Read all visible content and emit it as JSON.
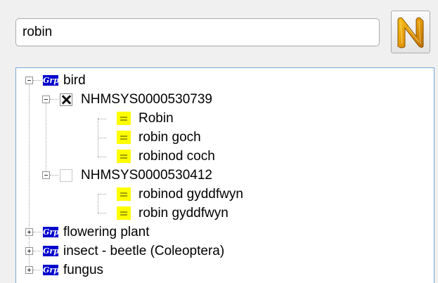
{
  "search": {
    "value": "robin"
  },
  "logo": {
    "icon": "n-logo-icon",
    "letter": "N"
  },
  "tree": {
    "groups": [
      {
        "label": "bird",
        "expanded": true,
        "icon_text": "Grp",
        "children": [
          {
            "label": "NHMSYS0000530739",
            "checked": true,
            "names": [
              "Robin",
              "robin goch",
              "robinod coch"
            ]
          },
          {
            "label": "NHMSYS0000530412",
            "checked": false,
            "names": [
              "robinod gyddfwyn",
              "robin gyddfwyn"
            ]
          }
        ]
      },
      {
        "label": "flowering plant",
        "expanded": false,
        "icon_text": "Grp"
      },
      {
        "label": "insect - beetle (Coleoptera)",
        "expanded": false,
        "icon_text": "Grp"
      },
      {
        "label": "fungus",
        "expanded": false,
        "icon_text": "Grp"
      }
    ]
  },
  "colors": {
    "group_icon": "#0000cc",
    "name_icon": "#ffff00",
    "tree_border": "#7aa7d6"
  }
}
